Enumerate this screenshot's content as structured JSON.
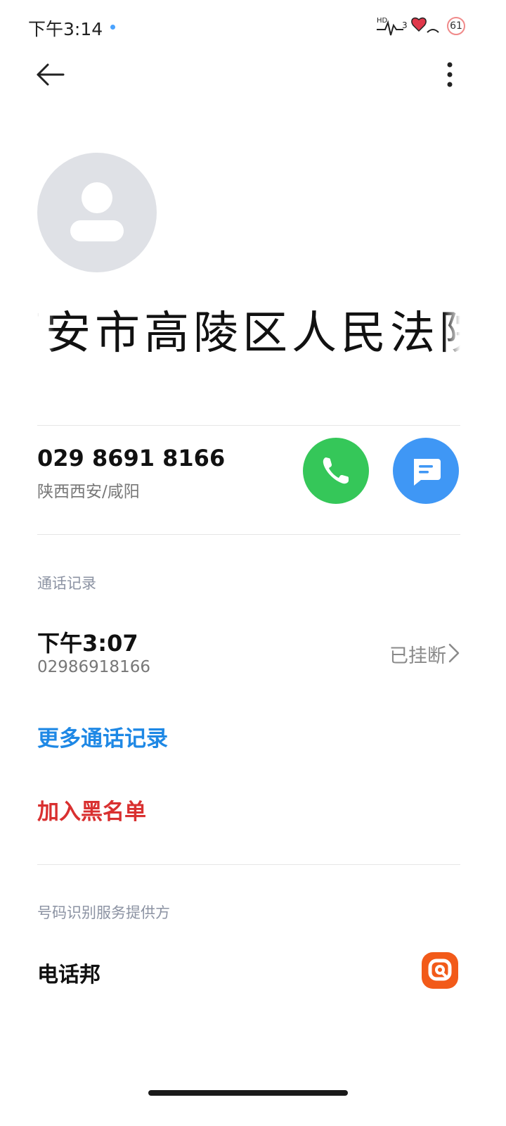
{
  "status_bar": {
    "time": "下午3:14",
    "battery": "61"
  },
  "contact": {
    "name": "西安市高陵区人民法院",
    "avatar_icon": "person-icon"
  },
  "phone": {
    "number": "029 8691 8166",
    "location": "陕西西安/咸阳",
    "call_color": "#35c759",
    "message_color": "#3f97f5"
  },
  "call_log": {
    "section_label": "通话记录",
    "entries": [
      {
        "time": "下午3:07",
        "number": "02986918166",
        "status": "已挂断"
      }
    ],
    "more_label": "更多通话记录"
  },
  "actions": {
    "blacklist_label": "加入黑名单"
  },
  "provider": {
    "section_label": "号码识别服务提供方",
    "name": "电话邦",
    "logo_color": "#f25a19"
  }
}
